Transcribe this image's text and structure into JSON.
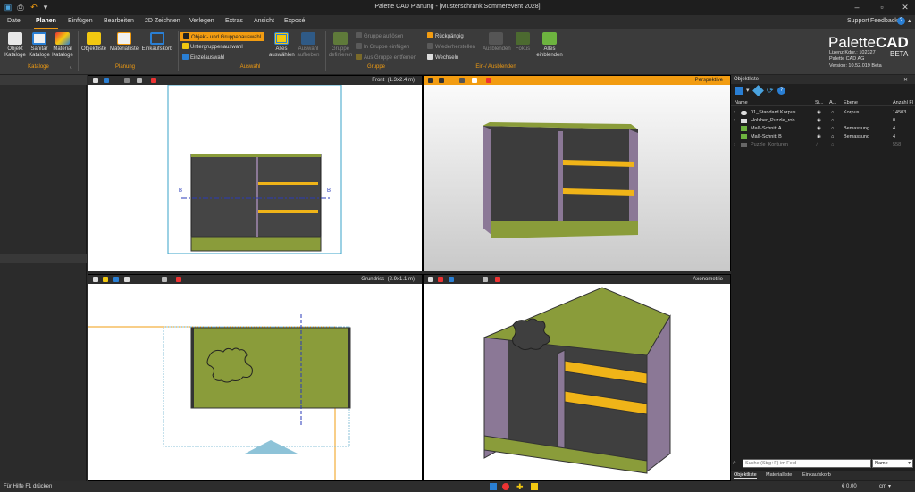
{
  "window": {
    "title": "Palette CAD Planung - [Musterschrank Sommerevent 2028]",
    "support": "Support",
    "feedback": "Feedback"
  },
  "menu": {
    "tabs": [
      "Datei",
      "Planen",
      "Einfügen",
      "Bearbeiten",
      "2D Zeichnen",
      "Verlegen",
      "Extras",
      "Ansicht",
      "Exposé"
    ],
    "active": "Planen"
  },
  "ribbon": {
    "kataloge": {
      "objekt": "Objekt Kataloge",
      "sanitaer": "Sanitär Kataloge",
      "material": "Material Kataloge",
      "group": "Kataloge"
    },
    "planung": {
      "objektliste": "Objektliste",
      "materialliste": "Materialliste",
      "einkaufskorb": "Einkaufskorb",
      "group": "Planung"
    },
    "auswahl": {
      "objekt_gruppen": "Objekt- und Gruppenauswahl",
      "untergruppen": "Untergruppenauswahl",
      "einzel": "Einzelauswahl",
      "alles_auswaehlen": "Alles auswählen",
      "auswahl_aufheben": "Auswahl aufheben",
      "group": "Auswahl"
    },
    "gruppe": {
      "definieren": "Gruppe definieren",
      "aufloesen": "Gruppe auflösen",
      "einfuegen": "In Gruppe einfügen",
      "entfernen": "Aus Gruppe entfernen",
      "group": "Gruppe"
    },
    "einaus": {
      "rueckgaengig": "Rückgängig",
      "wiederherstellen": "Wiederherstellen",
      "wechseln": "Wechseln",
      "ausblenden": "Ausblenden",
      "fokus": "Fokus",
      "alles_einblenden": "Alles einblenden",
      "group": "Ein-/ Ausblenden"
    }
  },
  "brand": {
    "name_a": "Palette",
    "name_b": "CAD",
    "license": "Lizenz Kdnr.: 102327",
    "company": "Palette CAD AG",
    "version": "Version: 10.52.019 Beta",
    "beta": "BETA"
  },
  "viewports": {
    "front": {
      "label": "Front",
      "scale": "(1.3x2.4 m)",
      "marker": "B"
    },
    "perspective": {
      "label": "Perspektive"
    },
    "grundriss": {
      "label": "Grundriss",
      "scale": "(2.9x1.1 m)"
    },
    "axonometrie": {
      "label": "Axonometrie"
    }
  },
  "objectlist": {
    "title": "Objektliste",
    "columns": [
      "Name",
      "Si...",
      "A...",
      "Ebene",
      "Anzahl Fl"
    ],
    "rows": [
      {
        "name": "01_Standard Korpus",
        "ebene": "Korpus",
        "count": "14503"
      },
      {
        "name": "Holzher_Puzzle_roh",
        "ebene": "",
        "count": "0"
      },
      {
        "name": "Maß-Schnitt A",
        "ebene": "Bemassung",
        "count": "4"
      },
      {
        "name": "Maß-Schnitt B",
        "ebene": "Bemassung",
        "count": "4"
      },
      {
        "name": "Puzzle_Konturen",
        "ebene": "",
        "count": "558"
      }
    ],
    "search_placeholder": "Suche (Strg+F) im Feld",
    "search_field": "Name",
    "bottom_tabs": [
      "Objektliste",
      "Materialliste",
      "Einkaufskorb"
    ]
  },
  "status": {
    "help": "Für Hilfe F1 drücken",
    "price": "€ 0.00",
    "unit": "cm"
  },
  "colors": {
    "accent": "#f29c11",
    "cabinet_green": "#8a9c3a",
    "cabinet_purple": "#8b7896",
    "shelf_yellow": "#f0b418",
    "cabinet_dark": "#454545"
  }
}
